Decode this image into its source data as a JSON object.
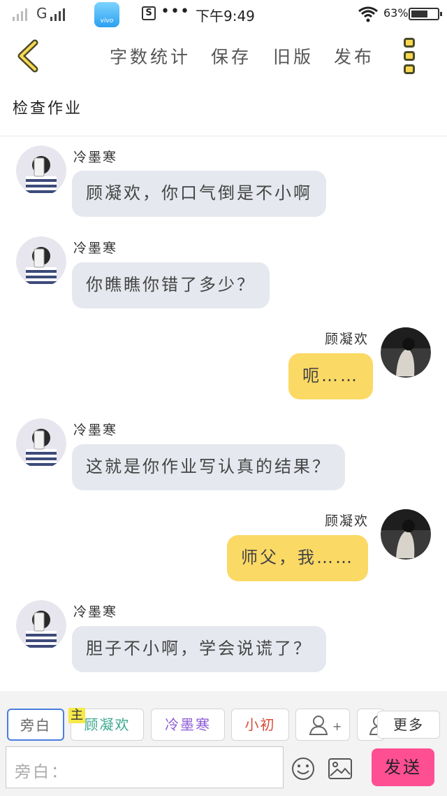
{
  "status_bar": {
    "network_label": "G",
    "time": "下午9:49",
    "battery_text": "63%",
    "battery_level_percent": 63,
    "app_icon_label": "vivo",
    "notification_icon": "S",
    "more_indicator": "•••"
  },
  "top_nav": {
    "items": [
      "字数统计",
      "保存",
      "旧版",
      "发布"
    ]
  },
  "chat": {
    "title": "检查作业",
    "messages": [
      {
        "speaker": "冷墨寒",
        "side": "left",
        "text": "顾凝欢，你口气倒是不小啊"
      },
      {
        "speaker": "冷墨寒",
        "side": "left",
        "text": "你瞧瞧你错了多少？"
      },
      {
        "speaker": "顾凝欢",
        "side": "right",
        "text": "呃……"
      },
      {
        "speaker": "冷墨寒",
        "side": "left",
        "text": "这就是你作业写认真的结果？"
      },
      {
        "speaker": "顾凝欢",
        "side": "right",
        "text": "师父，我……"
      },
      {
        "speaker": "冷墨寒",
        "side": "left",
        "text": "胆子不小啊，学会说谎了？"
      }
    ]
  },
  "bottom": {
    "roles": [
      {
        "label": "旁白",
        "color": "#666666"
      },
      {
        "label": "顾凝欢",
        "color": "#3aa88e"
      },
      {
        "label": "冷墨寒",
        "color": "#8c5bd6"
      },
      {
        "label": "小初",
        "color": "#d94b3b"
      }
    ],
    "main_tag": "主",
    "more_label": "更多",
    "add_role_symbol": "+",
    "input_placeholder": "旁白：",
    "send_label": "发送"
  },
  "colors": {
    "accent_yellow": "#fbd965",
    "bubble_gray": "#e5e8ee",
    "send_pink": "#ff4f93",
    "selected_blue": "#4a7de0"
  }
}
